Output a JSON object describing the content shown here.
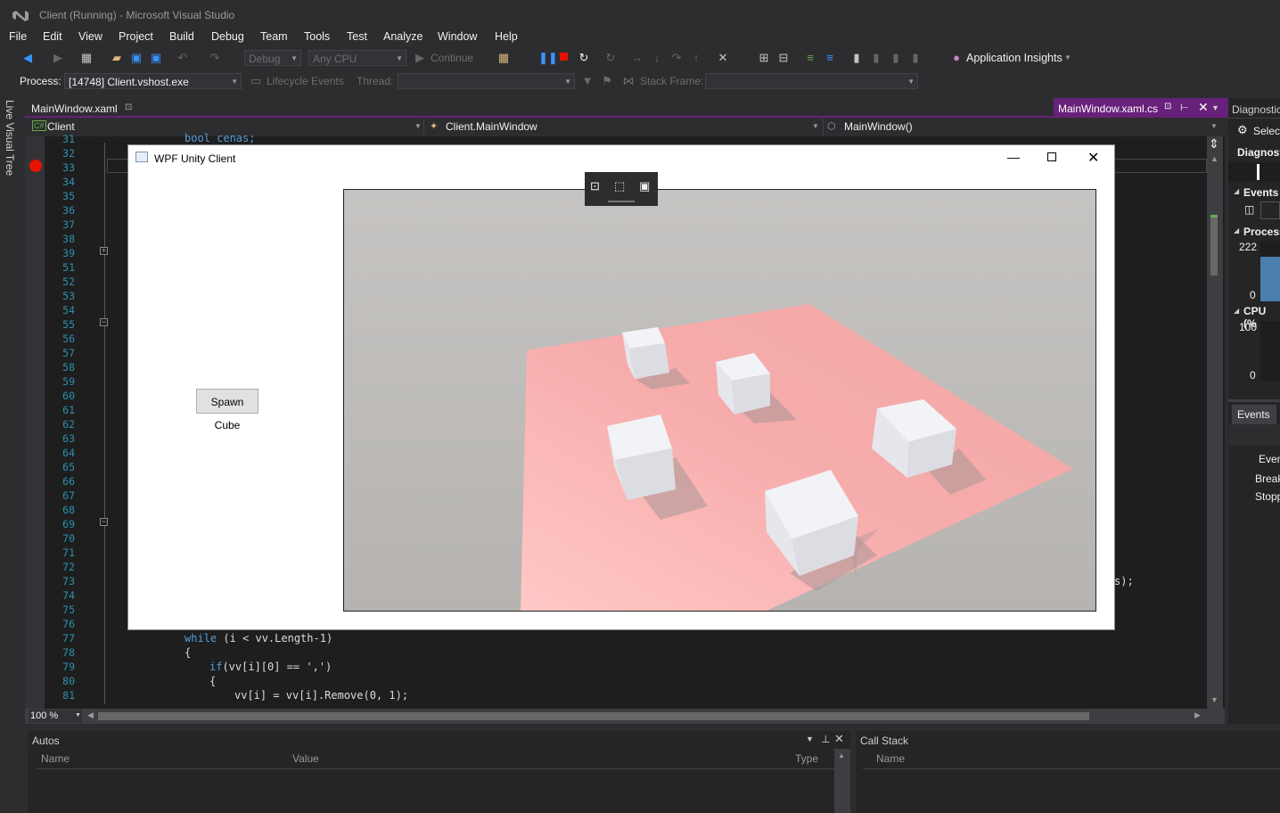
{
  "window": {
    "title": "Client (Running) - Microsoft Visual Studio"
  },
  "menu": [
    "File",
    "Edit",
    "View",
    "Project",
    "Build",
    "Debug",
    "Team",
    "Tools",
    "Test",
    "Analyze",
    "Window",
    "Help"
  ],
  "toolbar": {
    "config": "Debug",
    "platform": "Any CPU",
    "continue_label": "Continue",
    "app_insights": "Application Insights"
  },
  "debug_location": {
    "process_label": "Process:",
    "process_value": "[14748] Client.vshost.exe",
    "lifecycle_label": "Lifecycle Events",
    "thread_label": "Thread:",
    "stack_frame_label": "Stack Frame:"
  },
  "side_strip": {
    "label": "Live Visual Tree"
  },
  "tabs": {
    "left": "MainWindow.xaml",
    "right": "MainWindow.xaml.cs"
  },
  "nav": {
    "project": "Client",
    "type": "Client.MainWindow",
    "member": "MainWindow()"
  },
  "editor": {
    "line_numbers": [
      "31",
      "32",
      "33",
      "34",
      "35",
      "36",
      "37",
      "38",
      "39",
      "51",
      "52",
      "53",
      "54",
      "55",
      "56",
      "57",
      "58",
      "59",
      "60",
      "61",
      "62",
      "63",
      "64",
      "65",
      "66",
      "67",
      "68",
      "69",
      "70",
      "71",
      "72",
      "73",
      "74",
      "75",
      "76",
      "77",
      "78",
      "79",
      "80",
      "81"
    ],
    "line31": "bool cenas;",
    "line73_tail": "s);",
    "line77_kw": "while",
    "line77_rest": " (i < vv.Length-1)",
    "line78": "{",
    "line79_kw": "if",
    "line79_rest": "(vv[i][0] == ',')",
    "line80": "{",
    "line81": "vv[i] = vv[i].Remove(0, 1);",
    "zoom": "100 %"
  },
  "wpf": {
    "title": "WPF Unity Client",
    "spawn_button": "Spawn Cube"
  },
  "diagnostics": {
    "title": "Diagnostic",
    "select": "Select",
    "header": "Diagnost",
    "events": "Events",
    "process": "Process",
    "mem_max": "222",
    "mem_min": "0",
    "cpu": "CPU (%",
    "cpu_max": "100",
    "cpu_min": "0",
    "events_tab": "Events",
    "events_col": "Even",
    "row1": "Break",
    "row2": "Stopp"
  },
  "autos": {
    "title": "Autos",
    "columns": [
      "Name",
      "Value",
      "Type"
    ]
  },
  "callstack": {
    "title": "Call Stack",
    "columns": [
      "Name"
    ]
  },
  "colors": {
    "accent": "#68217a",
    "editor_bg": "#1e1e1e",
    "line_number": "#2b91af",
    "breakpoint": "#e51400",
    "floor": "#f4a9a8",
    "cube": "#e8e9ed"
  }
}
